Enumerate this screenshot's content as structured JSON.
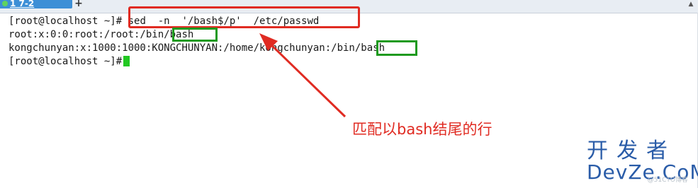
{
  "tab": {
    "label": "1 7-2",
    "add_label": "+"
  },
  "terminal": {
    "lines": [
      {
        "prompt": "[root@localhost ~]#",
        "command": " sed  -n  '/bash$/p'  /etc/passwd"
      },
      {
        "prefix": "root:x:0:0:root:/root:/bin",
        "match": "/bash"
      },
      {
        "prefix": "kongchunyan:x:1000:1000:KONGCHUNYAN:/home/kongchunyan:/bin",
        "match": "/bash"
      },
      {
        "prompt": "[root@localhost ~]#"
      }
    ],
    "cursor_color": "#22c822"
  },
  "annotation": {
    "text": "匹配以bash结尾的行",
    "color": "#e02b22"
  },
  "watermark": {
    "cn": "开发者",
    "en": "DevZe.CoM",
    "small": "@51CTO博客"
  },
  "colors": {
    "highlight_red": "#e02b22",
    "highlight_green": "#1f9a1f",
    "tab_active": "#3d8fd6"
  }
}
